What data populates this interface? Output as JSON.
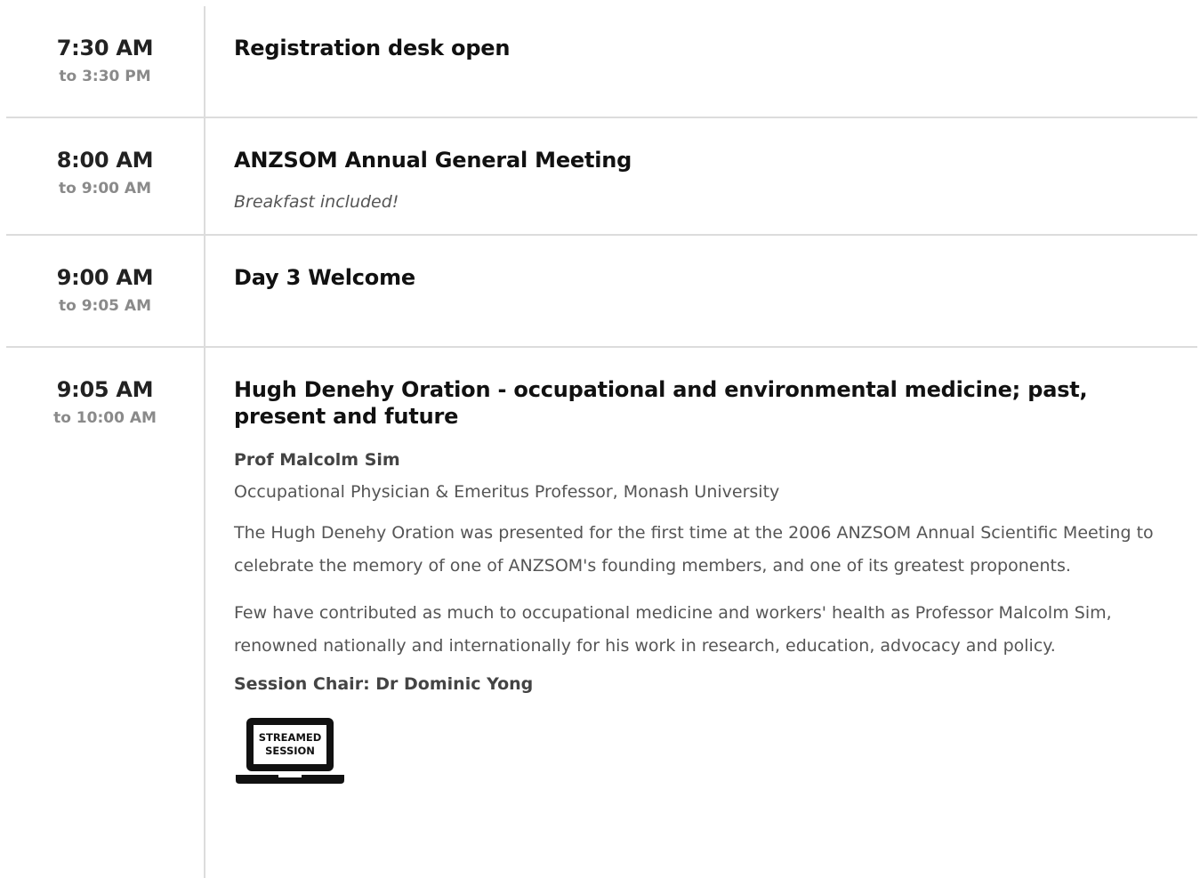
{
  "sessions": [
    {
      "start": "7:30 AM",
      "end": "to 3:30 PM",
      "title": "Registration desk open"
    },
    {
      "start": "8:00 AM",
      "end": "to 9:00 AM",
      "title": "ANZSOM Annual General Meeting",
      "note": "Breakfast included!"
    },
    {
      "start": "9:00 AM",
      "end": "to 9:05 AM",
      "title": "Day 3 Welcome"
    },
    {
      "start": "9:05 AM",
      "end": "to 10:00 AM",
      "title": "Hugh Denehy Oration - occupational and environmental medicine; past, present and future",
      "speaker_name": "Prof Malcolm Sim",
      "speaker_role": "Occupational Physician & Emeritus Professor, Monash University",
      "paragraphs": [
        "The Hugh Denehy Oration was presented for the first time at the 2006 ANZSOM Annual Scientific Meeting to celebrate the memory of one of ANZSOM's founding members, and one of its greatest proponents.",
        "Few have contributed as much to occupational medicine and workers' health as Professor Malcolm Sim, renowned nationally and internationally for his work in research, education, advocacy and policy."
      ],
      "chair": "Session Chair: Dr Dominic Yong",
      "badge": {
        "line1": "STREAMED",
        "line2": "SESSION",
        "icon": "laptop-icon"
      }
    }
  ]
}
